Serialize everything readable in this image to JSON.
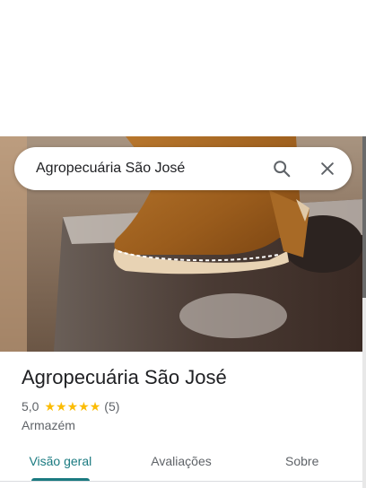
{
  "search": {
    "query": "Agropecuária São José"
  },
  "place": {
    "name": "Agropecuária São José",
    "rating": "5,0",
    "review_count": "(5)",
    "stars": 5,
    "category": "Armazém"
  },
  "tabs": [
    {
      "label": "Visão geral",
      "active": true
    },
    {
      "label": "Avaliações",
      "active": false
    },
    {
      "label": "Sobre",
      "active": false
    }
  ],
  "colors": {
    "accent": "#1a7a80",
    "star": "#fbbc04"
  },
  "icons": {
    "search": "search-icon",
    "close": "close-icon"
  }
}
